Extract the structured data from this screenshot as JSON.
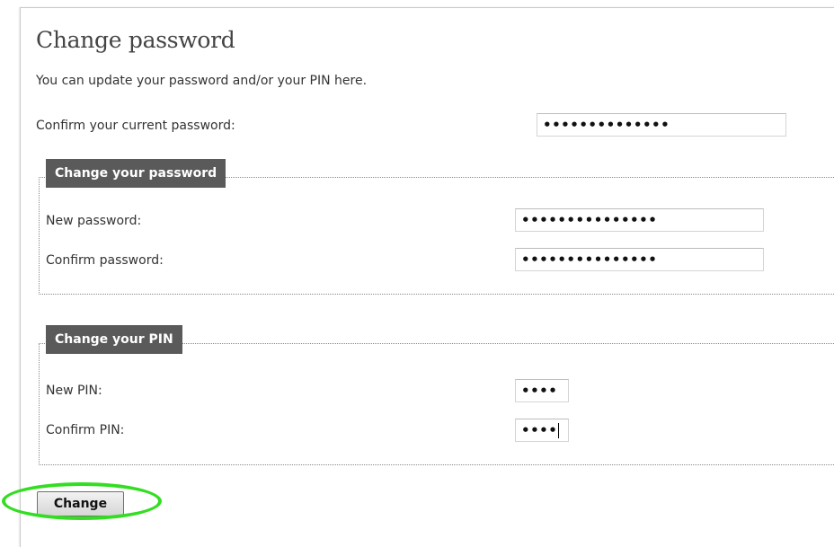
{
  "page": {
    "title": "Change password",
    "subtitle": "You can update your password and/or your PIN here."
  },
  "current_password": {
    "label": "Confirm your current password:",
    "value": "••••••••••••••"
  },
  "password_section": {
    "legend": "Change your password",
    "new_label": "New password:",
    "new_value": "•••••••••••••••",
    "confirm_label": "Confirm password:",
    "confirm_value": "•••••••••••••••"
  },
  "pin_section": {
    "legend": "Change your PIN",
    "new_label": "New PIN:",
    "new_value": "••••",
    "confirm_label": "Confirm PIN:",
    "confirm_value": "••••"
  },
  "actions": {
    "change_label": "Change"
  },
  "colors": {
    "legend_bg": "#5a5a5a",
    "highlight": "#33dd22"
  }
}
